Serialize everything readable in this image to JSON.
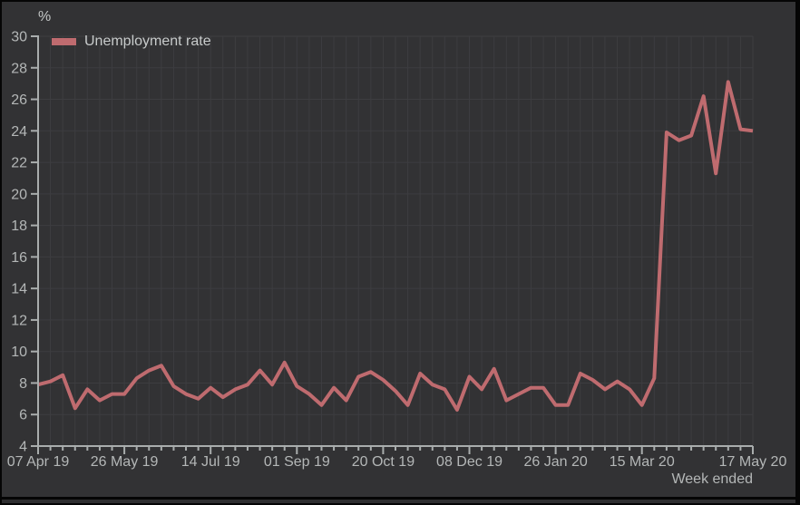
{
  "chart_data": {
    "type": "line",
    "title": "",
    "ylabel": "%",
    "xlabel": "Week ended",
    "ylim": [
      4,
      30
    ],
    "ytick_step": 2,
    "weeks_total": 58,
    "x_start": "07 Apr 19",
    "x_end": "17 May 20",
    "x_tick_weeks": [
      0,
      7,
      14,
      21,
      28,
      35,
      42,
      49,
      58
    ],
    "x_tick_labels": [
      "07 Apr 19",
      "26 May 19",
      "14 Jul 19",
      "01 Sep 19",
      "20 Oct 19",
      "08 Dec 19",
      "26 Jan 20",
      "15 Mar 20",
      "17 May 20"
    ],
    "grid": true,
    "legend_position": "top-left",
    "series": [
      {
        "name": "Unemployment rate",
        "color": "#bf6b6f",
        "values": [
          7.9,
          8.1,
          8.5,
          6.4,
          7.6,
          6.9,
          7.3,
          7.3,
          8.3,
          8.8,
          9.1,
          7.8,
          7.3,
          7.0,
          7.7,
          7.1,
          7.6,
          7.9,
          8.8,
          7.9,
          9.3,
          7.8,
          7.3,
          6.6,
          7.7,
          6.9,
          8.4,
          8.7,
          8.2,
          7.5,
          6.6,
          8.6,
          7.9,
          7.6,
          6.3,
          8.4,
          7.6,
          8.9,
          6.9,
          7.3,
          7.7,
          7.7,
          6.6,
          6.6,
          8.6,
          8.2,
          7.6,
          8.1,
          7.6,
          6.6,
          8.3,
          23.9,
          23.4,
          23.7,
          26.2,
          21.3,
          27.1,
          24.1,
          24.0
        ]
      }
    ]
  },
  "colors": {
    "line": "#bf6b6f",
    "panel_background": "#323234",
    "gridline": "#3d3d40",
    "axis": "#a9adad",
    "tick_label": "#b4b7b7",
    "frame": "#050505"
  }
}
